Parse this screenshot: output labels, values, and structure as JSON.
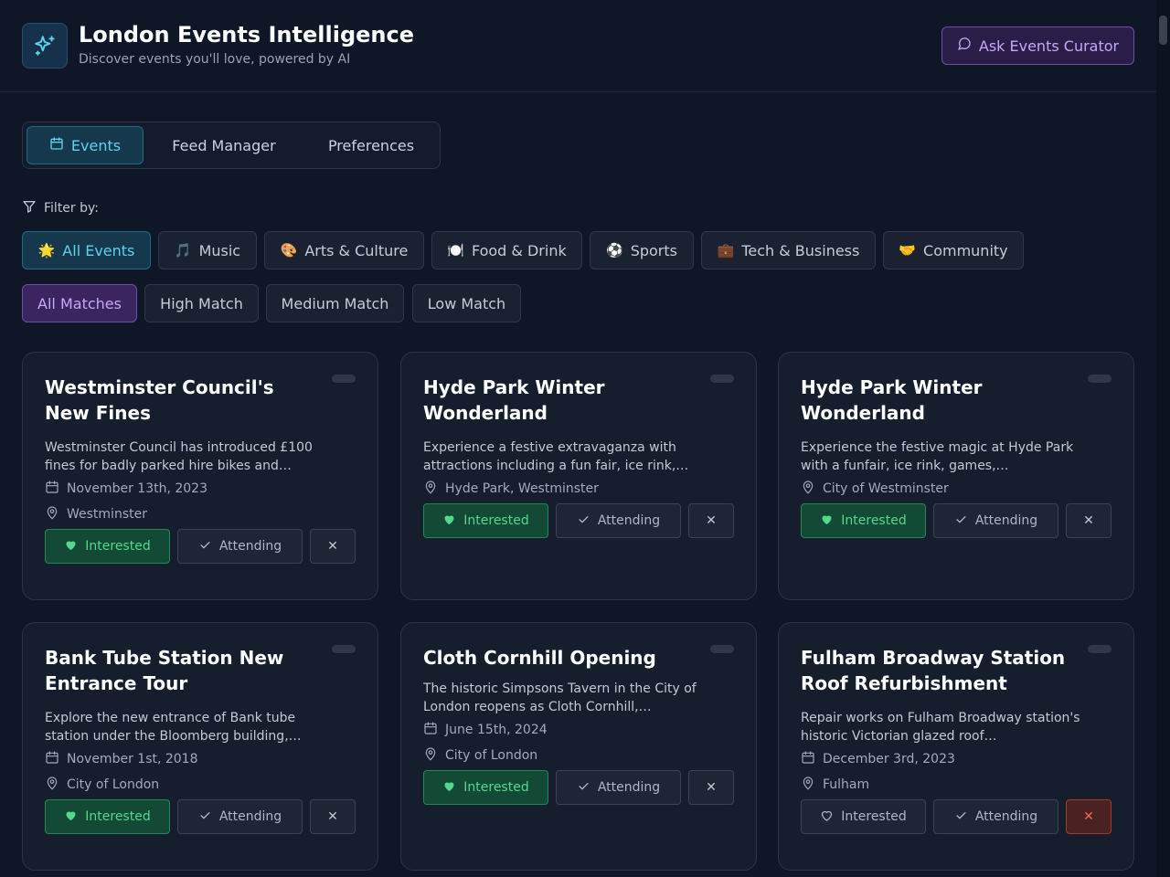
{
  "header": {
    "title": "London Events Intelligence",
    "subtitle": "Discover events you'll love, powered by AI",
    "curator_button": "Ask Events Curator"
  },
  "tabs": [
    "Events",
    "Feed Manager",
    "Preferences"
  ],
  "filter_label": "Filter by:",
  "categories": [
    {
      "emoji": "🌟",
      "label": "All Events"
    },
    {
      "emoji": "🎵",
      "label": "Music"
    },
    {
      "emoji": "🎨",
      "label": "Arts & Culture"
    },
    {
      "emoji": "🍽️",
      "label": "Food & Drink"
    },
    {
      "emoji": "⚽",
      "label": "Sports"
    },
    {
      "emoji": "💼",
      "label": "Tech & Business"
    },
    {
      "emoji": "🤝",
      "label": "Community"
    }
  ],
  "matches": [
    "All Matches",
    "High Match",
    "Medium Match",
    "Low Match"
  ],
  "buttons": {
    "interested": "Interested",
    "attending": "Attending",
    "dismiss": "✕"
  },
  "events": [
    {
      "title": "Westminster Council's New Fines",
      "description": "Westminster Council has introduced £100 fines for badly parked hire bikes and…",
      "date": "November 13th, 2023",
      "location": "Westminster",
      "interested": true,
      "dismissed": false
    },
    {
      "title": "Hyde Park Winter Wonderland",
      "description": "Experience a festive extravaganza with attractions including a fun fair, ice rink,…",
      "date": "",
      "location": "Hyde Park, Westminster",
      "interested": true,
      "dismissed": false
    },
    {
      "title": "Hyde Park Winter Wonderland",
      "description": "Experience the festive magic at Hyde Park with a funfair, ice rink, games,…",
      "date": "",
      "location": "City of Westminster",
      "interested": true,
      "dismissed": false
    },
    {
      "title": "Bank Tube Station New Entrance Tour",
      "description": "Explore the new entrance of Bank tube station under the Bloomberg building,…",
      "date": "November 1st, 2018",
      "location": "City of London",
      "interested": true,
      "dismissed": false
    },
    {
      "title": "Cloth Cornhill Opening",
      "description": "The historic Simpsons Tavern in the City of London reopens as Cloth Cornhill,…",
      "date": "June 15th, 2024",
      "location": "City of London",
      "interested": true,
      "dismissed": false
    },
    {
      "title": "Fulham Broadway Station Roof Refurbishment",
      "description": "Repair works on Fulham Broadway station's historic Victorian glazed roof…",
      "date": "December 3rd, 2023",
      "location": "Fulham",
      "interested": false,
      "dismissed": true
    }
  ]
}
